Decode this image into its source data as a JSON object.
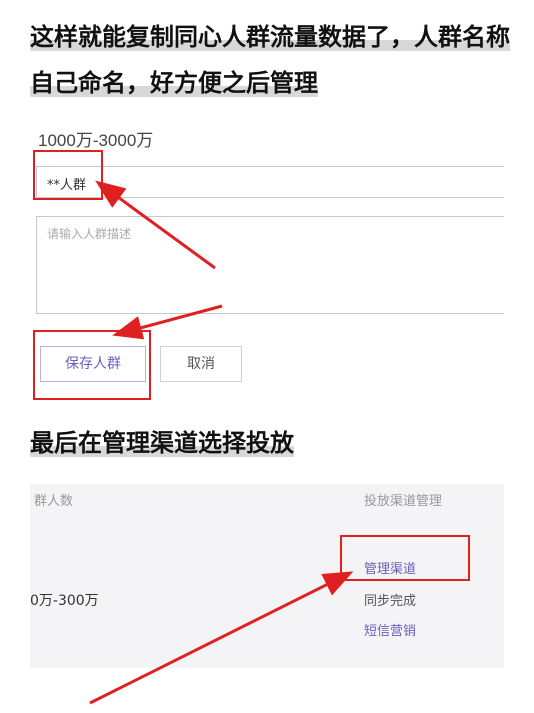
{
  "heading1": "这样就能复制同心人群流量数据了，人群名称自己命名，好方便之后管理",
  "heading2": "最后在管理渠道选择投放",
  "form": {
    "range": "1000万-3000万",
    "name_value": "**人群",
    "desc_placeholder": "请输入人群描述",
    "save_label": "保存人群",
    "cancel_label": "取消"
  },
  "table": {
    "col_left": "群人数",
    "col_right": "投放渠道管理",
    "row_value": "0万-300万",
    "menu": [
      "管理渠道",
      "同步完成",
      "短信营销"
    ]
  },
  "colors": {
    "highlight": "#e02020",
    "accent": "#6a5fb8"
  }
}
